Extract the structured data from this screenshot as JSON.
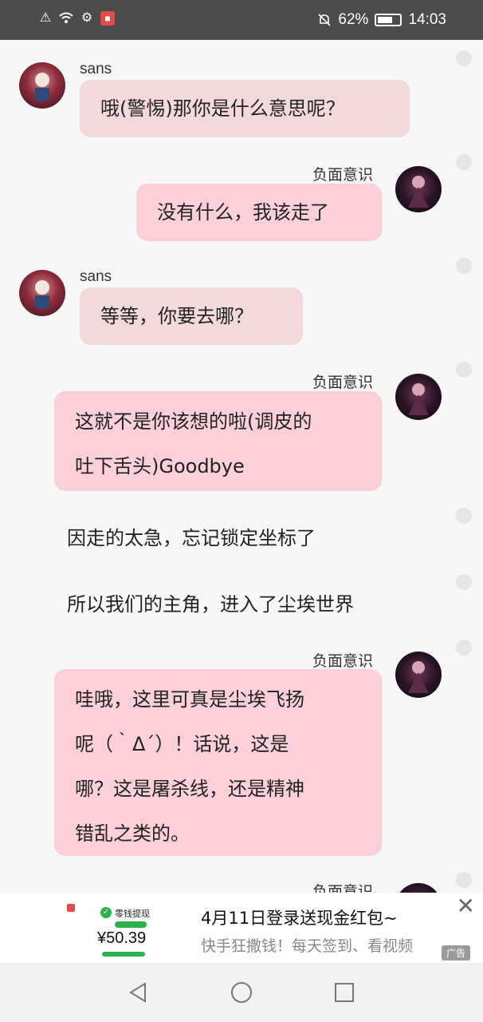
{
  "status_bar": {
    "battery": "62%",
    "time": "14:03",
    "icons": [
      "alert-icon",
      "wifi-icon",
      "update-icon",
      "book-icon",
      "mute-icon",
      "battery-icon"
    ]
  },
  "chat": [
    {
      "speaker": "sans",
      "text": "哦(警惕)那你是什么意思呢？"
    },
    {
      "speaker": "负面意识",
      "text": "没有什么，我该走了"
    },
    {
      "speaker": "sans",
      "text": "等等，你要去哪？"
    },
    {
      "speaker": "负面意识",
      "lines": [
        "这就不是你该想的啦(调皮的",
        "吐下舌头)Goodbye"
      ]
    },
    {
      "narration": "因走的太急，忘记锁定坐标了"
    },
    {
      "narration": "所以我们的主角，进入了尘埃世界"
    },
    {
      "speaker": "负面意识",
      "lines": [
        "哇哦，这里可真是尘埃飞扬",
        "呢（｀Δ´）！话说，这是",
        "哪？这是屠杀线，还是精神",
        "错乱之类的。"
      ]
    },
    {
      "speaker": "负面意识",
      "text": ""
    }
  ],
  "ad": {
    "thumb_label": "零钱提现",
    "thumb_amount": "¥50.39",
    "title": "4月11日登录送现金红包~",
    "subtitle": "快手狂撒钱！每天签到、看视频",
    "badge": "广告"
  },
  "nav": {
    "icons": [
      "back-icon",
      "home-icon",
      "recents-icon"
    ]
  },
  "colors": {
    "sans_bubble": "#f3d9db",
    "neg_bubble": "#fbd0d8",
    "status_bar": "#4b4b4b"
  }
}
